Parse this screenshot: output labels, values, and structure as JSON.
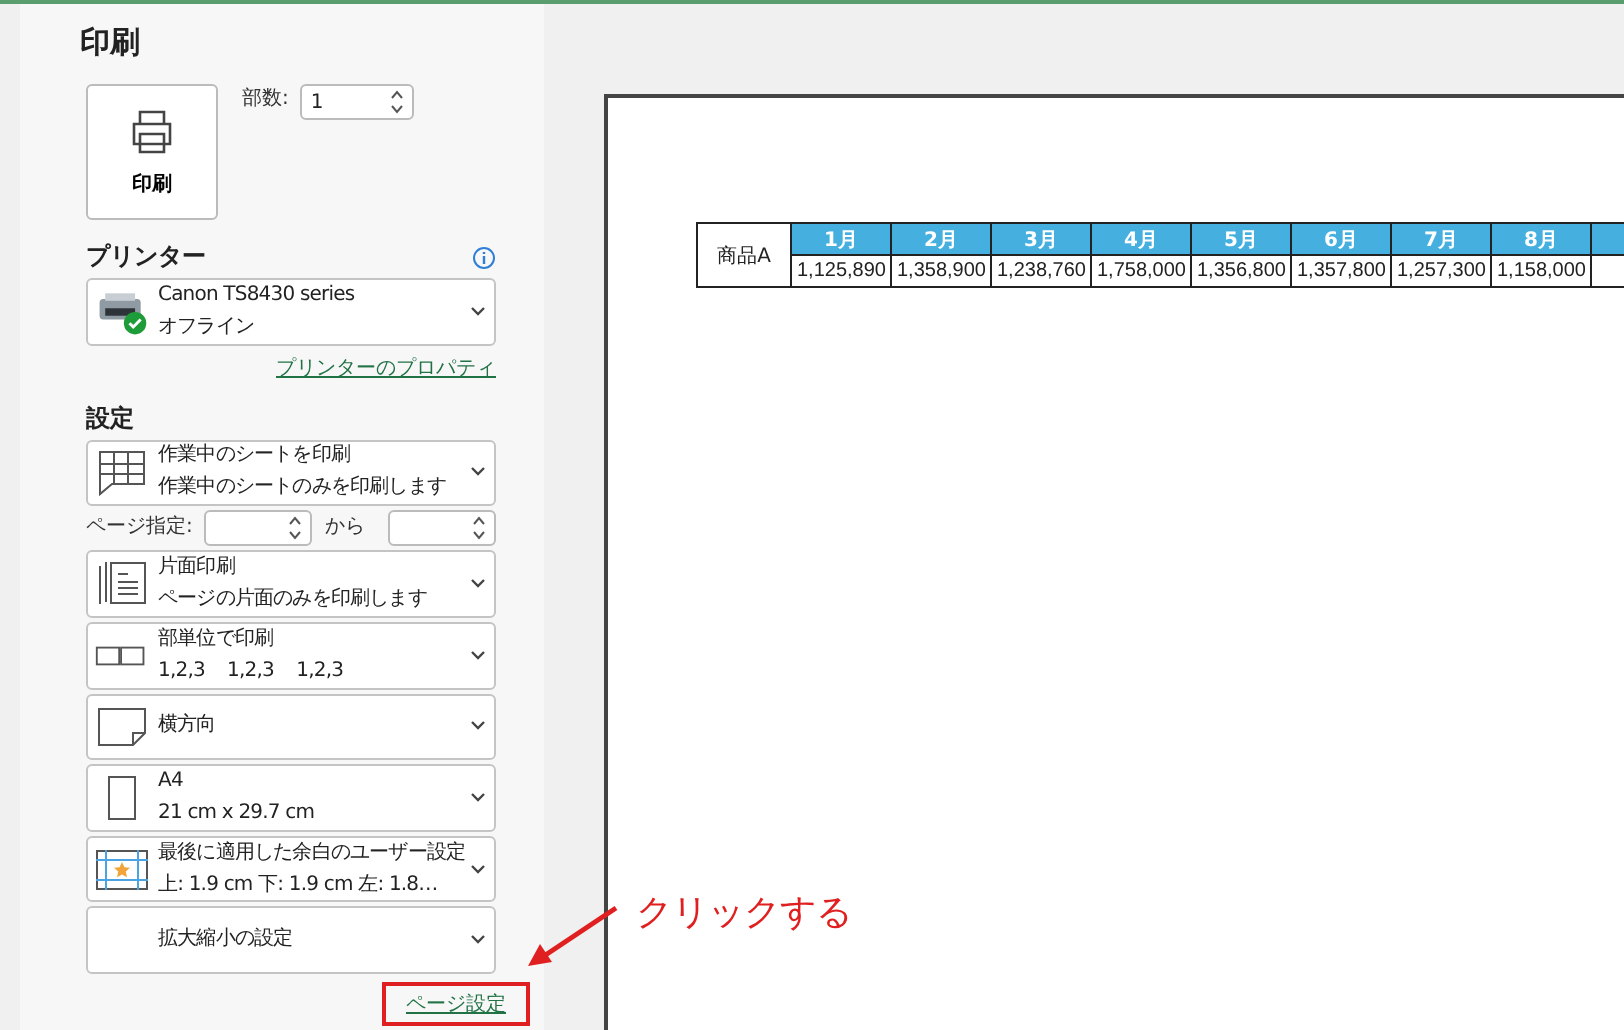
{
  "title": "印刷",
  "print_button": {
    "label": "印刷"
  },
  "copies": {
    "label": "部数:",
    "value": "1"
  },
  "printer": {
    "heading": "プリンター",
    "name": "Canon TS8430 series",
    "status": "オフライン",
    "properties_link": "プリンターのプロパティ"
  },
  "settings": {
    "heading": "設定",
    "items": [
      {
        "kind": "sheets",
        "title": "作業中のシートを印刷",
        "subtitle": "作業中のシートのみを印刷します"
      },
      {
        "kind": "range",
        "label": "ページ指定:",
        "between": "から"
      },
      {
        "kind": "sides",
        "title": "片面印刷",
        "subtitle": "ページの片面のみを印刷します"
      },
      {
        "kind": "collate",
        "title": "部単位で印刷",
        "subtitle": "1,2,3    1,2,3    1,2,3"
      },
      {
        "kind": "orientation",
        "title": "横方向"
      },
      {
        "kind": "paper",
        "title": "A4",
        "subtitle": "21 cm x 29.7 cm"
      },
      {
        "kind": "margins",
        "title": "最後に適用した余白のユーザー設定",
        "subtitle": "上: 1.9 cm 下: 1.9 cm 左: 1.8…"
      },
      {
        "kind": "scaling",
        "title": "拡大縮小の設定"
      }
    ]
  },
  "page_setup_link": "ページ設定",
  "annotation": {
    "text": "クリックする"
  },
  "preview": {
    "row_label": "商品A",
    "months": [
      "1月",
      "2月",
      "3月",
      "4月",
      "5月",
      "6月",
      "7月",
      "8月"
    ],
    "values": [
      "1,125,890",
      "1,358,900",
      "1,238,760",
      "1,758,000",
      "1,356,800",
      "1,357,800",
      "1,257,300",
      "1,158,000"
    ]
  }
}
